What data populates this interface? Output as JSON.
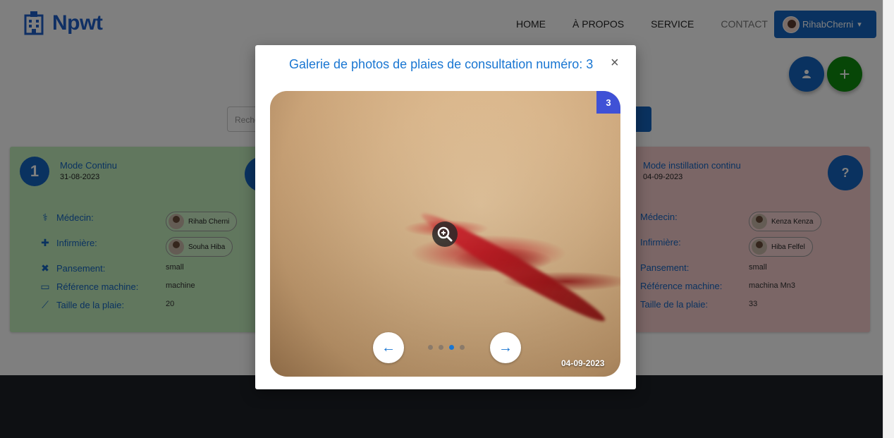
{
  "navbar": {
    "brand": "Npwt",
    "links": [
      "HOME",
      "À PROPOS",
      "SERVICE",
      "CONTACT"
    ],
    "user_name": "RihabCherni"
  },
  "search": {
    "placeholder": "Reche"
  },
  "cards": [
    {
      "number": "1",
      "mode": "Mode Continu",
      "date": "31-08-2023",
      "medecin_label": "Médecin:",
      "medecin": "Rihab Cherni",
      "infirmiere_label": "Infirmière:",
      "infirmiere": "Souha Hiba",
      "pansement_label": "Pansement:",
      "pansement": "small",
      "reference_label": "Référence machine:",
      "reference": "machine",
      "taille_label": "Taille de la plaie:",
      "taille": "20"
    },
    {
      "mode": "Mode instillation continu",
      "date": "04-09-2023",
      "help": "?",
      "medecin_label": "Médecin:",
      "medecin": "Kenza Kenza",
      "infirmiere_label": "Infirmière:",
      "infirmiere": "Hiba Felfel",
      "pansement_label": "Pansement:",
      "pansement": "small",
      "reference_label": "Référence machine:",
      "reference": "machina Mn3",
      "taille_label": "Taille de la plaie:",
      "taille": "33"
    }
  ],
  "modal": {
    "title": "Galerie de photos de plaies de consultation numéro: 3",
    "close": "×",
    "counter": "3",
    "photo_date": "04-09-2023",
    "dots_total": 4,
    "dots_active_index": 2
  },
  "colors": {
    "primary": "#1565c0",
    "green": "#0e8c0e",
    "card_green": "#c3eebd",
    "card_red": "#f7cdcd",
    "counter": "#3f51d6"
  }
}
